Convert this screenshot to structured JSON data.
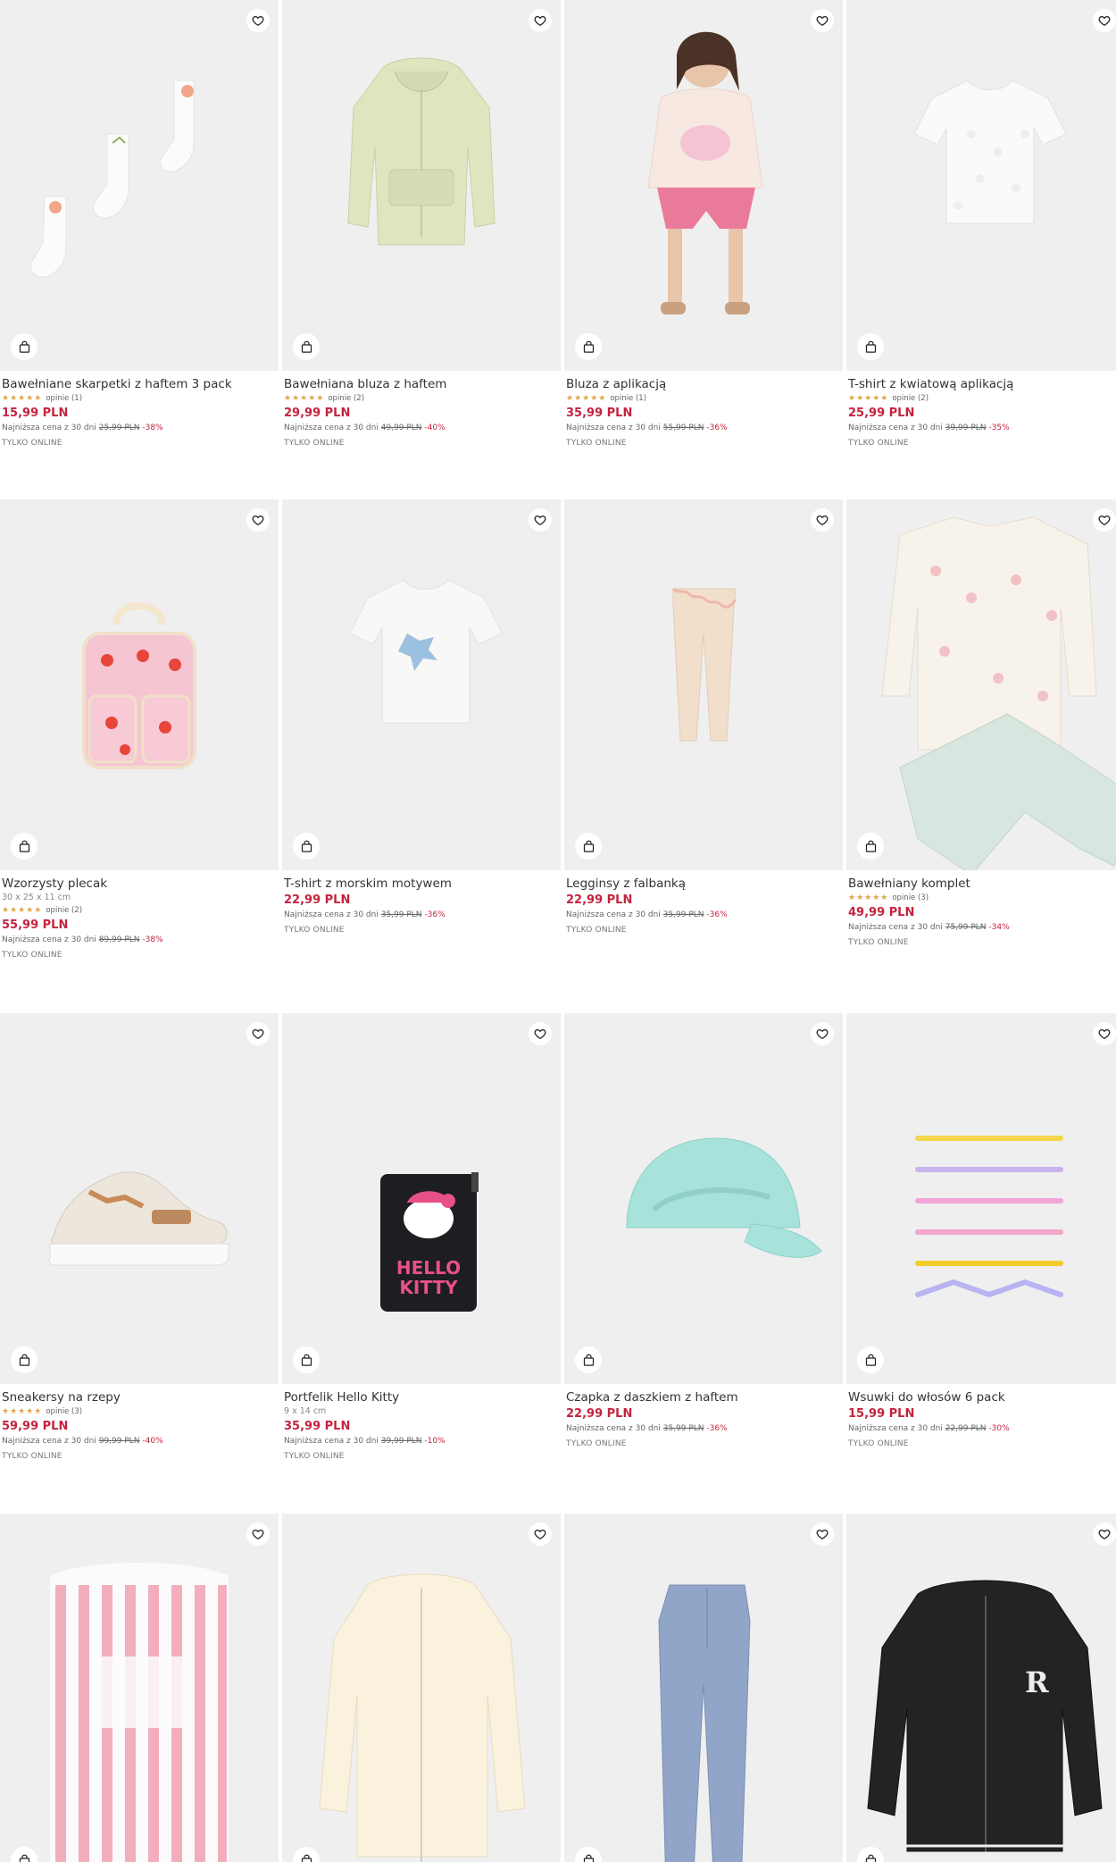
{
  "products": [
    {
      "name": "Bawełniane skarpetki z haftem 3 pack",
      "subtitle": "",
      "stars": "★★★★★",
      "reviews": "opinie (1)",
      "price": "15,99 PLN",
      "lowest_label": "Najniższa cena z 30 dni",
      "old_price": "25,99 PLN",
      "discount": "-38%",
      "badge": "TYLKO ONLINE",
      "icon": "socks"
    },
    {
      "name": "Bawełniana bluza z haftem",
      "subtitle": "",
      "stars": "★★★★★",
      "reviews": "opinie (2)",
      "price": "29,99 PLN",
      "lowest_label": "Najniższa cena z 30 dni",
      "old_price": "49,99 PLN",
      "discount": "-40%",
      "badge": "TYLKO ONLINE",
      "icon": "hoodie"
    },
    {
      "name": "Bluza z aplikacją",
      "subtitle": "",
      "stars": "★★★★★",
      "reviews": "opinie (1)",
      "price": "35,99 PLN",
      "lowest_label": "Najniższa cena z 30 dni",
      "old_price": "55,99 PLN",
      "discount": "-36%",
      "badge": "TYLKO ONLINE",
      "icon": "girl-model"
    },
    {
      "name": "T-shirt z kwiatową aplikacją",
      "subtitle": "",
      "stars": "★★★★★",
      "reviews": "opinie (2)",
      "price": "25,99 PLN",
      "lowest_label": "Najniższa cena z 30 dni",
      "old_price": "39,99 PLN",
      "discount": "-35%",
      "badge": "TYLKO ONLINE",
      "icon": "tshirt"
    },
    {
      "name": "Wzorzysty plecak",
      "subtitle": "30 x 25 x 11 cm",
      "stars": "★★★★★",
      "reviews": "opinie (2)",
      "price": "55,99 PLN",
      "lowest_label": "Najniższa cena z 30 dni",
      "old_price": "89,99 PLN",
      "discount": "-38%",
      "badge": "TYLKO ONLINE",
      "icon": "backpack"
    },
    {
      "name": "T-shirt z morskim motywem",
      "subtitle": "",
      "stars": "",
      "reviews": "",
      "price": "22,99 PLN",
      "lowest_label": "Najniższa cena z 30 dni",
      "old_price": "35,99 PLN",
      "discount": "-36%",
      "badge": "TYLKO ONLINE",
      "icon": "tshirt-sea"
    },
    {
      "name": "Legginsy z falbanką",
      "subtitle": "",
      "stars": "",
      "reviews": "",
      "price": "22,99 PLN",
      "lowest_label": "Najniższa cena z 30 dni",
      "old_price": "35,99 PLN",
      "discount": "-36%",
      "badge": "TYLKO ONLINE",
      "icon": "leggings"
    },
    {
      "name": "Bawełniany komplet",
      "subtitle": "",
      "stars": "★★★★★",
      "reviews": "opinie (3)",
      "price": "49,99 PLN",
      "lowest_label": "Najniższa cena z 30 dni",
      "old_price": "75,99 PLN",
      "discount": "-34%",
      "badge": "TYLKO ONLINE",
      "icon": "set"
    },
    {
      "name": "Sneakersy na rzepy",
      "subtitle": "",
      "stars": "★★★★★",
      "reviews": "opinie (3)",
      "price": "59,99 PLN",
      "lowest_label": "Najniższa cena z 30 dni",
      "old_price": "99,99 PLN",
      "discount": "-40%",
      "badge": "TYLKO ONLINE",
      "icon": "sneaker"
    },
    {
      "name": "Portfelik Hello Kitty",
      "subtitle": "9 x 14 cm",
      "stars": "",
      "reviews": "",
      "price": "35,99 PLN",
      "lowest_label": "Najniższa cena z 30 dni",
      "old_price": "39,99 PLN",
      "discount": "-10%",
      "badge": "TYLKO ONLINE",
      "icon": "wallet"
    },
    {
      "name": "Czapka z daszkiem z haftem",
      "subtitle": "",
      "stars": "",
      "reviews": "",
      "price": "22,99 PLN",
      "lowest_label": "Najniższa cena z 30 dni",
      "old_price": "35,99 PLN",
      "discount": "-36%",
      "badge": "TYLKO ONLINE",
      "icon": "cap"
    },
    {
      "name": "Wsuwki do włosów 6 pack",
      "subtitle": "",
      "stars": "",
      "reviews": "",
      "price": "15,99 PLN",
      "lowest_label": "Najniższa cena z 30 dni",
      "old_price": "22,99 PLN",
      "discount": "-30%",
      "badge": "TYLKO ONLINE",
      "icon": "hairclips"
    },
    {
      "name": "",
      "subtitle": "",
      "stars": "",
      "reviews": "",
      "price": "",
      "lowest_label": "",
      "old_price": "",
      "discount": "",
      "badge": "",
      "icon": "towel-poncho"
    },
    {
      "name": "",
      "subtitle": "",
      "stars": "",
      "reviews": "",
      "price": "",
      "lowest_label": "",
      "old_price": "",
      "discount": "",
      "badge": "",
      "icon": "jacket-cream"
    },
    {
      "name": "",
      "subtitle": "",
      "stars": "",
      "reviews": "",
      "price": "",
      "lowest_label": "",
      "old_price": "",
      "discount": "",
      "badge": "",
      "icon": "trousers"
    },
    {
      "name": "",
      "subtitle": "",
      "stars": "",
      "reviews": "",
      "price": "",
      "lowest_label": "",
      "old_price": "",
      "discount": "",
      "badge": "",
      "icon": "bomber-black"
    }
  ],
  "icons": {
    "wishlist": "heart-icon",
    "cart": "shopping-bag-icon"
  },
  "colors": {
    "price": "#c4233e",
    "stars": "#e1a64c",
    "tile_bg": "#efefef"
  }
}
